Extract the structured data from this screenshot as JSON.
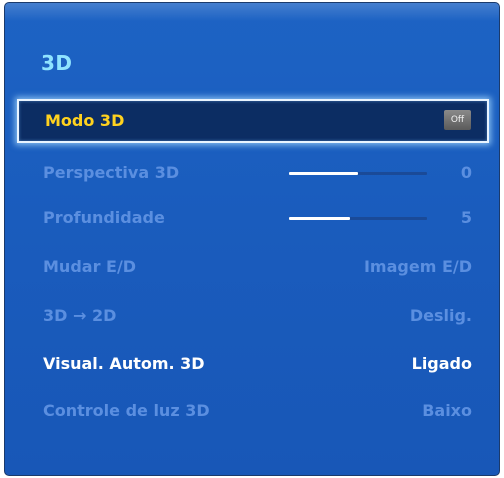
{
  "menu": {
    "title": "3D",
    "items": [
      {
        "label": "Modo 3D",
        "value": "Off",
        "kind": "badge",
        "selected": true
      },
      {
        "label": "Perspectiva 3D",
        "value": "0",
        "kind": "slider",
        "level_fraction": 0.5
      },
      {
        "label": "Profundidade",
        "value": "5",
        "kind": "slider",
        "level_fraction": 0.44
      },
      {
        "label": "Mudar E/D",
        "value": "Imagem E/D",
        "kind": "text"
      },
      {
        "label": "3D → 2D",
        "value": "Deslig.",
        "kind": "text"
      },
      {
        "label": "Visual. Autom. 3D",
        "value": "Ligado",
        "kind": "text",
        "enabled": true
      },
      {
        "label": "Controle de luz 3D",
        "value": "Baixo",
        "kind": "text"
      }
    ]
  },
  "colors": {
    "background": "#1a5cbd",
    "title": "#8fe3ff",
    "selected_label": "#ffd21f",
    "disabled_text": "#5b8fe0",
    "enabled_text": "#ffffff",
    "selected_bg": "#0c2d63"
  }
}
